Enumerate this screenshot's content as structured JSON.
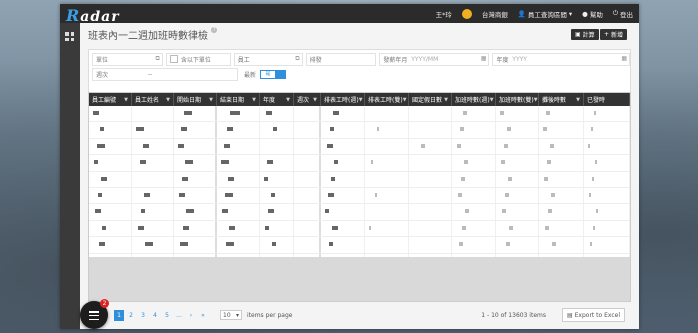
{
  "app": {
    "logo_prefix": "R",
    "logo_rest": "adar",
    "title": "班表內一二週加班時數律檢"
  },
  "topnav": {
    "user": "王*玲",
    "company": "台灣商銀",
    "menu": "員工查詢區間",
    "help": "幫助",
    "logout": "登出"
  },
  "buttons": {
    "calc": "計算",
    "add": "新增"
  },
  "filters": {
    "unit": "單位",
    "include_sub": "含以下單位",
    "employee": "員工",
    "position": "排發",
    "issue_month": "發薪年月",
    "issue_month_ph": "YYYY/MM",
    "year": "年度",
    "year_ph": "YYYY",
    "week": "週次",
    "week_value": "--",
    "latest": "最新",
    "latest_value": "是"
  },
  "table": {
    "headers": [
      "員工編號",
      "員工姓名",
      "開始日期",
      "結束日期",
      "年度",
      "週次",
      "排表工時(週)",
      "排表工時(雙)",
      "國定假日數",
      "加班時數(週)",
      "加班時數(雙)",
      "攤後時數",
      "已發時"
    ],
    "row_count": 10
  },
  "pager": {
    "pages": [
      "1",
      "2",
      "3",
      "4",
      "5",
      "...",
      "›",
      "»"
    ],
    "active": "1",
    "per_page": "10",
    "per_page_label": "items per page",
    "summary": "1 - 10 of 13603 items",
    "export": "Export to Excel"
  },
  "fab": {
    "badge": "2"
  },
  "colors": {
    "accent": "#2f8fdc",
    "header": "#333333",
    "topbar": "#2b2b2b"
  }
}
